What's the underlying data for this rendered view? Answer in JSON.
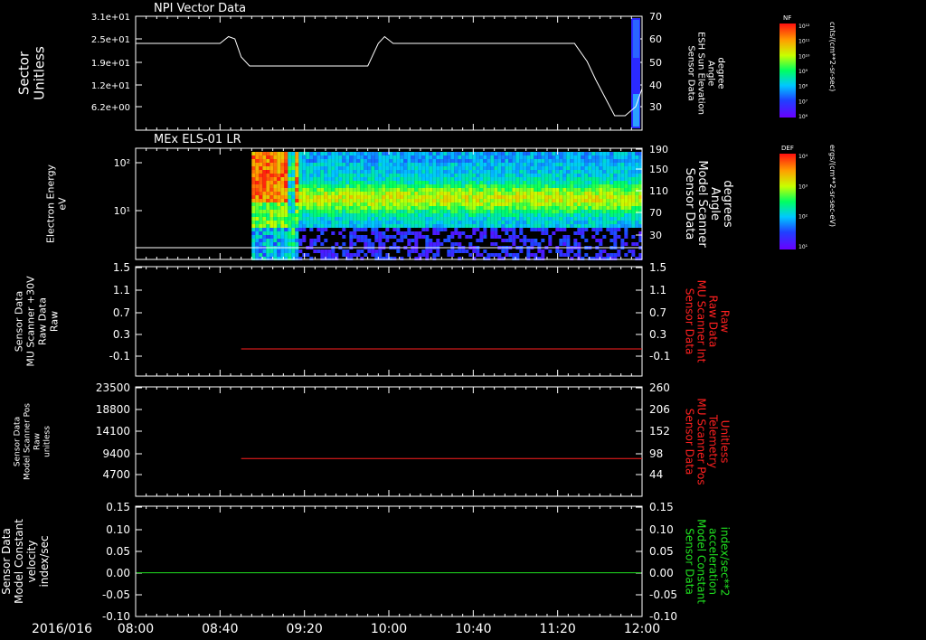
{
  "chart_data": [
    {
      "type": "line",
      "panel_title": "NPI Vector Data",
      "ylabel_left": [
        "Sector",
        "Unitless"
      ],
      "yticks_left": [
        "3.1e+01",
        "2.5e+01",
        "1.9e+01",
        "1.2e+01",
        "6.2e+00"
      ],
      "ylabel_right": [
        "Sensor Data",
        "ESH Sun Elevation",
        "Angle",
        "degree"
      ],
      "yticks_right": [
        "70",
        "60",
        "50",
        "40",
        "30"
      ],
      "ylim_right": [
        20,
        70
      ],
      "series": [
        {
          "x": [
            "08:00",
            "08:40",
            "08:44",
            "08:47",
            "08:50",
            "08:54",
            "09:50",
            "09:55",
            "09:58",
            "10:02",
            "11:28",
            "11:34",
            "11:38",
            "11:47",
            "11:52",
            "11:57",
            "12:00"
          ],
          "y": [
            58,
            58,
            61,
            60,
            52,
            48,
            48,
            58,
            61,
            58,
            58,
            50,
            42,
            26,
            26,
            30,
            38
          ]
        }
      ],
      "colorbar": {
        "label": "NF",
        "ticks": [
          "10¹²",
          "10¹¹",
          "10¹⁰",
          "10⁹",
          "10⁸",
          "10⁷",
          "10⁶"
        ],
        "unit": "cnts/(cm**2-sr-sec)"
      }
    },
    {
      "type": "heatmap",
      "panel_title": "MEx ELS-01 LR",
      "ylabel_left": [
        "Electron Energy",
        "eV"
      ],
      "yticks_left": [
        "10²",
        "10¹"
      ],
      "ylabel_right": [
        "Sensor Data",
        "Model Scanner",
        "Angle",
        "degrees"
      ],
      "yticks_right": [
        "190",
        "150",
        "110",
        "70",
        "30"
      ],
      "colorbar": {
        "label": "DEF",
        "ticks": [
          "10⁴",
          "10³",
          "10²",
          "10¹"
        ],
        "unit": "ergs/(cm**2-sr-sec-eV)"
      },
      "scan_angle_line_value": 10,
      "data_start": "08:55",
      "data_end": "12:00"
    },
    {
      "type": "line",
      "ylabel_left": [
        "Sensor Data",
        "MU Scanner +30V",
        "Raw Data",
        "Raw"
      ],
      "yticks_left": [
        "1.5",
        "1.1",
        "0.7",
        "0.3",
        "-0.1"
      ],
      "yticks_right": [
        "1.5",
        "1.1",
        "0.7",
        "0.3",
        "-0.1"
      ],
      "ylim": [
        -0.5,
        1.5
      ],
      "ylabel_right": [
        "Sensor Data",
        "MU Scanner Int",
        "Raw Data",
        "Raw"
      ],
      "series_color": "#ff2020",
      "series": [
        {
          "x": [
            "08:50",
            "12:00"
          ],
          "y": [
            -0.1,
            -0.1
          ]
        }
      ]
    },
    {
      "type": "line",
      "ylabel_left": [
        "Sensor Data",
        "Model Scanner Pos",
        "Raw",
        "unitless"
      ],
      "yticks_left": [
        "23500",
        "18800",
        "14100",
        "9400",
        "4700"
      ],
      "ylim_left": [
        0,
        23500
      ],
      "yticks_right": [
        "260",
        "206",
        "152",
        "98",
        "44"
      ],
      "ylim_right": [
        0,
        260
      ],
      "ylabel_right": [
        "Sensor Data",
        "MU Scanner Pos",
        "Telemetry",
        "Unitless"
      ],
      "series_color": "#ff2020",
      "series": [
        {
          "x": [
            "08:50",
            "12:00"
          ],
          "y": [
            84,
            84
          ]
        }
      ]
    },
    {
      "type": "line",
      "ylabel_left": [
        "Sensor Data",
        "Model Constant",
        "velocity",
        "index/sec"
      ],
      "yticks_left": [
        "0.15",
        "0.10",
        "0.05",
        "0.00",
        "-0.05",
        "-0.10"
      ],
      "yticks_right": [
        "0.15",
        "0.10",
        "0.05",
        "0.00",
        "-0.05",
        "-0.10"
      ],
      "ylim": [
        -0.1,
        0.15
      ],
      "ylabel_right": [
        "Sensor Data",
        "Model Constant",
        "acceleration",
        "index/sec**2"
      ],
      "series_color": "#20e020",
      "series": [
        {
          "x": [
            "08:00",
            "12:00"
          ],
          "y": [
            0.0,
            0.0
          ]
        }
      ]
    }
  ],
  "x_axis": {
    "date_label": "2016/016",
    "ticks": [
      "08:00",
      "08:40",
      "09:20",
      "10:00",
      "10:40",
      "11:20",
      "12:00"
    ],
    "range": [
      "08:00",
      "12:00"
    ]
  },
  "colors": {
    "frame": "#ffffff",
    "red_trace": "#ff2020",
    "green_trace": "#20e020"
  }
}
